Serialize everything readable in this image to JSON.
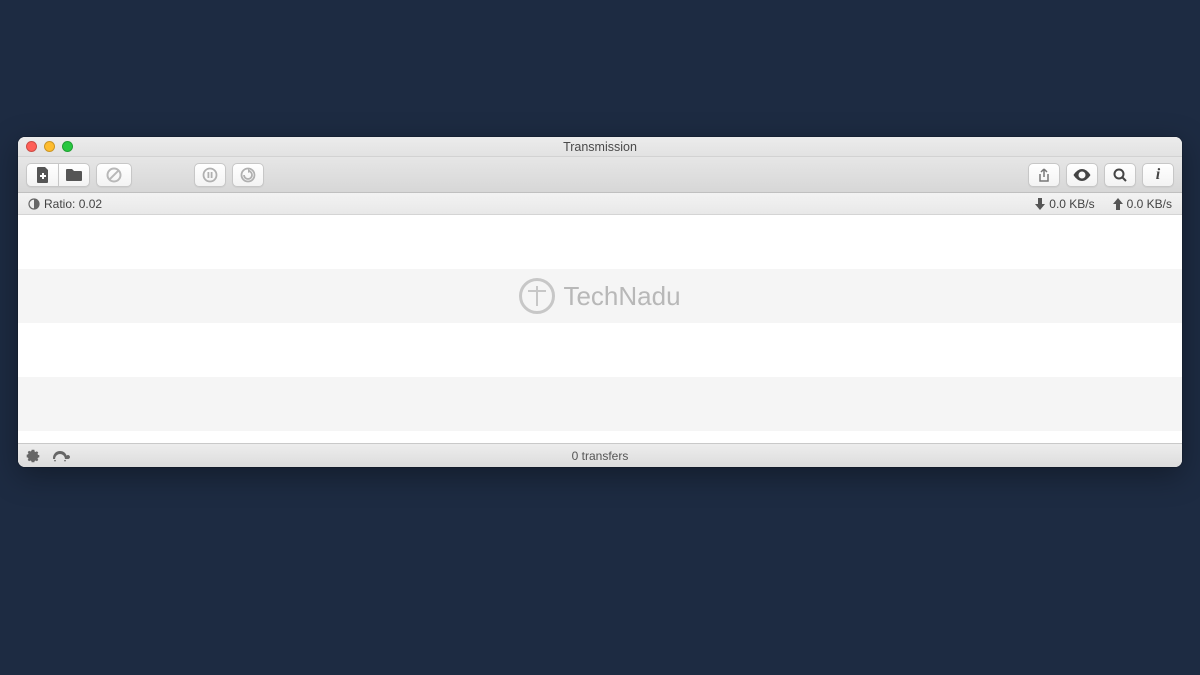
{
  "window": {
    "title": "Transmission"
  },
  "toolbar": {
    "create": "create-torrent",
    "open": "open-torrent",
    "remove": "remove-torrent",
    "pause": "pause-torrent",
    "resume": "resume-torrent",
    "share": "share",
    "quicklook": "quicklook",
    "search": "search",
    "info": "info"
  },
  "stats": {
    "ratio_label": "Ratio:",
    "ratio_value": "0.02",
    "download_speed": "0.0 KB/s",
    "upload_speed": "0.0 KB/s"
  },
  "watermark": {
    "text": "TechNadu"
  },
  "footer": {
    "transfers_text": "0 transfers"
  }
}
